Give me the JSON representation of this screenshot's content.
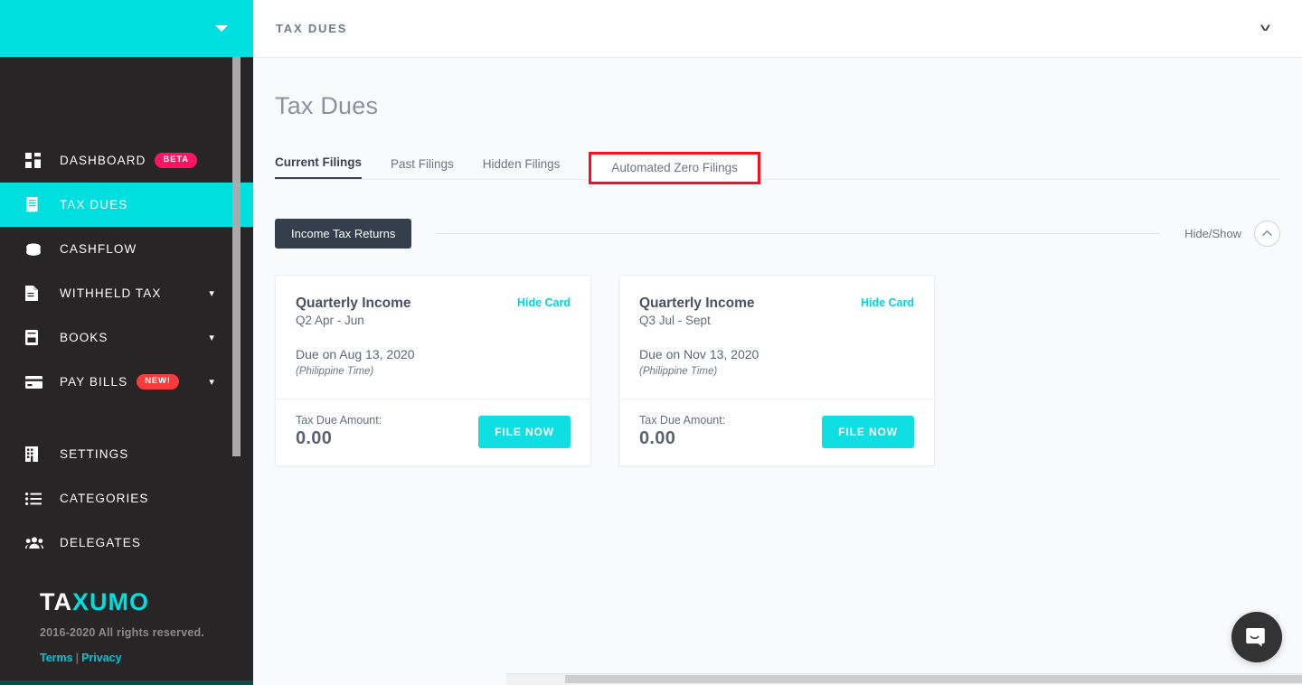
{
  "sidebar": {
    "header": {
      "caret_icon": "caret-down-icon"
    },
    "items": [
      {
        "label": "DASHBOARD",
        "icon": "grid-icon",
        "badge": "BETA",
        "badge_color": "#ff1464",
        "active": false,
        "expandable": false
      },
      {
        "label": "TAX DUES",
        "icon": "receipt-icon",
        "badge": null,
        "active": true,
        "expandable": false
      },
      {
        "label": "CASHFLOW",
        "icon": "coins-icon",
        "badge": null,
        "active": false,
        "expandable": false
      },
      {
        "label": "WITHHELD TAX",
        "icon": "document-icon",
        "badge": null,
        "active": false,
        "expandable": true
      },
      {
        "label": "BOOKS",
        "icon": "book-icon",
        "badge": null,
        "active": false,
        "expandable": true
      },
      {
        "label": "PAY BILLS",
        "icon": "card-icon",
        "badge": "NEW!",
        "badge_color": "#fb3b3b",
        "active": false,
        "expandable": true
      }
    ],
    "items_lower": [
      {
        "label": "SETTINGS",
        "icon": "building-icon"
      },
      {
        "label": "CATEGORIES",
        "icon": "list-icon"
      },
      {
        "label": "DELEGATES",
        "icon": "people-icon"
      }
    ],
    "brand": {
      "part1": "TA",
      "part2": "XUMO"
    },
    "copyright": "2016-2020 All rights reserved.",
    "legal": {
      "terms": "Terms",
      "separator": "|",
      "privacy": "Privacy"
    },
    "accent_color": "#00dfe0",
    "background_color": "#272525"
  },
  "topbar": {
    "title": "TAX DUES",
    "chevron_icon": "chevron-down-icon"
  },
  "main": {
    "page_title": "Tax Dues",
    "tabs": [
      {
        "label": "Current Filings",
        "active": true,
        "highlighted": false
      },
      {
        "label": "Past Filings",
        "active": false,
        "highlighted": false
      },
      {
        "label": "Hidden Filings",
        "active": false,
        "highlighted": false
      },
      {
        "label": "Automated Zero Filings",
        "active": false,
        "highlighted": true
      }
    ],
    "highlight_color": "#fc0d1b",
    "section": {
      "chip_label": "Income Tax Returns",
      "hide_show_label": "Hide/Show",
      "collapse_icon": "chevron-up-icon"
    },
    "cards": [
      {
        "title": "Quarterly Income",
        "subtitle": "Q2 Apr - Jun",
        "hide_label": "Hide Card",
        "due_text": "Due on Aug 13, 2020",
        "timezone": "(Philippine Time)",
        "amount_label": "Tax Due Amount:",
        "amount_value": "0.00",
        "action_label": "FILE NOW"
      },
      {
        "title": "Quarterly Income",
        "subtitle": "Q3 Jul - Sept",
        "hide_label": "Hide Card",
        "due_text": "Due on Nov 13, 2020",
        "timezone": "(Philippine Time)",
        "amount_label": "Tax Due Amount:",
        "amount_value": "0.00",
        "action_label": "FILE NOW"
      }
    ]
  },
  "widgets": {
    "intercom": {
      "icon": "chat-smile-icon"
    }
  }
}
